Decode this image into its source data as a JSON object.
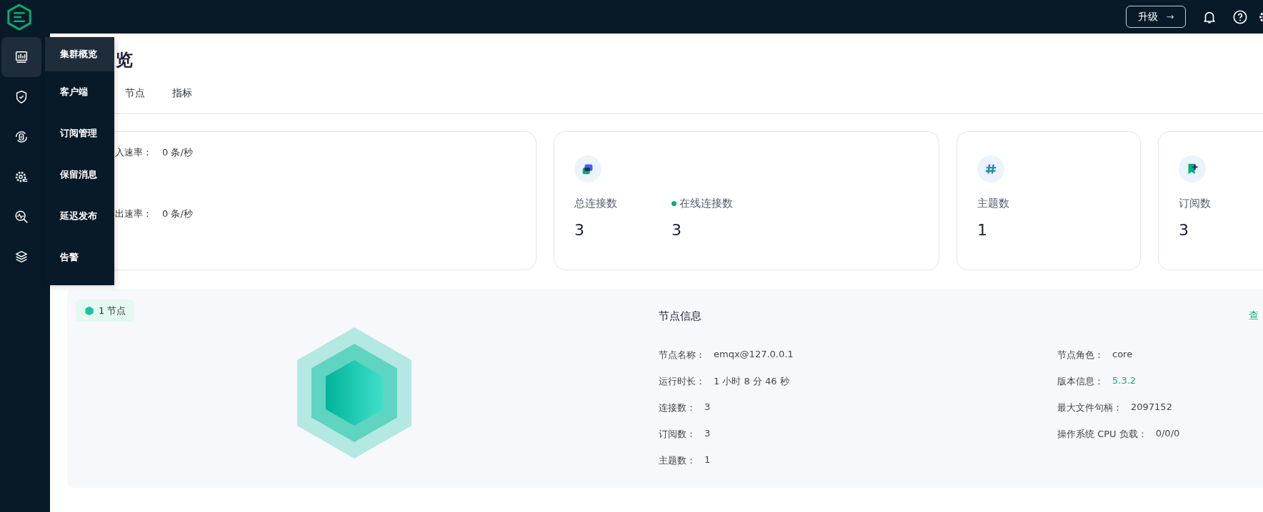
{
  "topbar": {
    "upgrade_button": "升级",
    "upgrade_arrow": "→"
  },
  "sidebar": {
    "items": [
      {
        "selected": true
      },
      {
        "selected": false
      },
      {
        "selected": false
      },
      {
        "selected": false
      },
      {
        "selected": false
      },
      {
        "selected": false
      }
    ]
  },
  "menu": {
    "items": [
      {
        "label": "集群概览",
        "selected": true
      },
      {
        "label": "客户端",
        "selected": false
      },
      {
        "label": "订阅管理",
        "selected": false
      },
      {
        "label": "保留消息",
        "selected": false
      },
      {
        "label": "延迟发布",
        "selected": false
      },
      {
        "label": "告警",
        "selected": false
      }
    ]
  },
  "page": {
    "title": "览",
    "tabs": [
      {
        "label": "节点",
        "selected": false
      },
      {
        "label": "指标",
        "selected": false
      }
    ]
  },
  "rate_card": {
    "rows": [
      {
        "label": "入速率：",
        "value": "0 条/秒"
      },
      {
        "label": "出速率：",
        "value": "0 条/秒"
      }
    ]
  },
  "stat_cards": [
    {
      "kind": "connections",
      "stats": [
        {
          "label": "总连接数",
          "value": "3",
          "online": false
        },
        {
          "label": "在线连接数",
          "value": "3",
          "online": true
        }
      ]
    },
    {
      "kind": "topics",
      "stats": [
        {
          "label": "主题数",
          "value": "1",
          "online": false
        }
      ]
    },
    {
      "kind": "subscriptions",
      "stats": [
        {
          "label": "订阅数",
          "value": "3",
          "online": false
        }
      ]
    }
  ],
  "node_panel": {
    "badge": "1 节点",
    "title": "节点信息",
    "link": "查",
    "left": [
      {
        "label": "节点名称：",
        "value": "emqx@127.0.0.1"
      },
      {
        "label": "运行时长：",
        "value": "1 小时 8 分 46 秒"
      },
      {
        "label": "连接数：",
        "value": "3"
      },
      {
        "label": "订阅数：",
        "value": "3"
      },
      {
        "label": "主题数：",
        "value": "1"
      }
    ],
    "right": [
      {
        "label": "节点角色：",
        "value": "core",
        "highlighted": false
      },
      {
        "label": "版本信息：",
        "value": "5.3.2",
        "highlighted": true
      },
      {
        "label": "最大文件句柄：",
        "value": "2097152",
        "highlighted": false
      },
      {
        "label": "操作系统 CPU 负载：",
        "value": "0/0/0",
        "highlighted": false
      }
    ]
  }
}
